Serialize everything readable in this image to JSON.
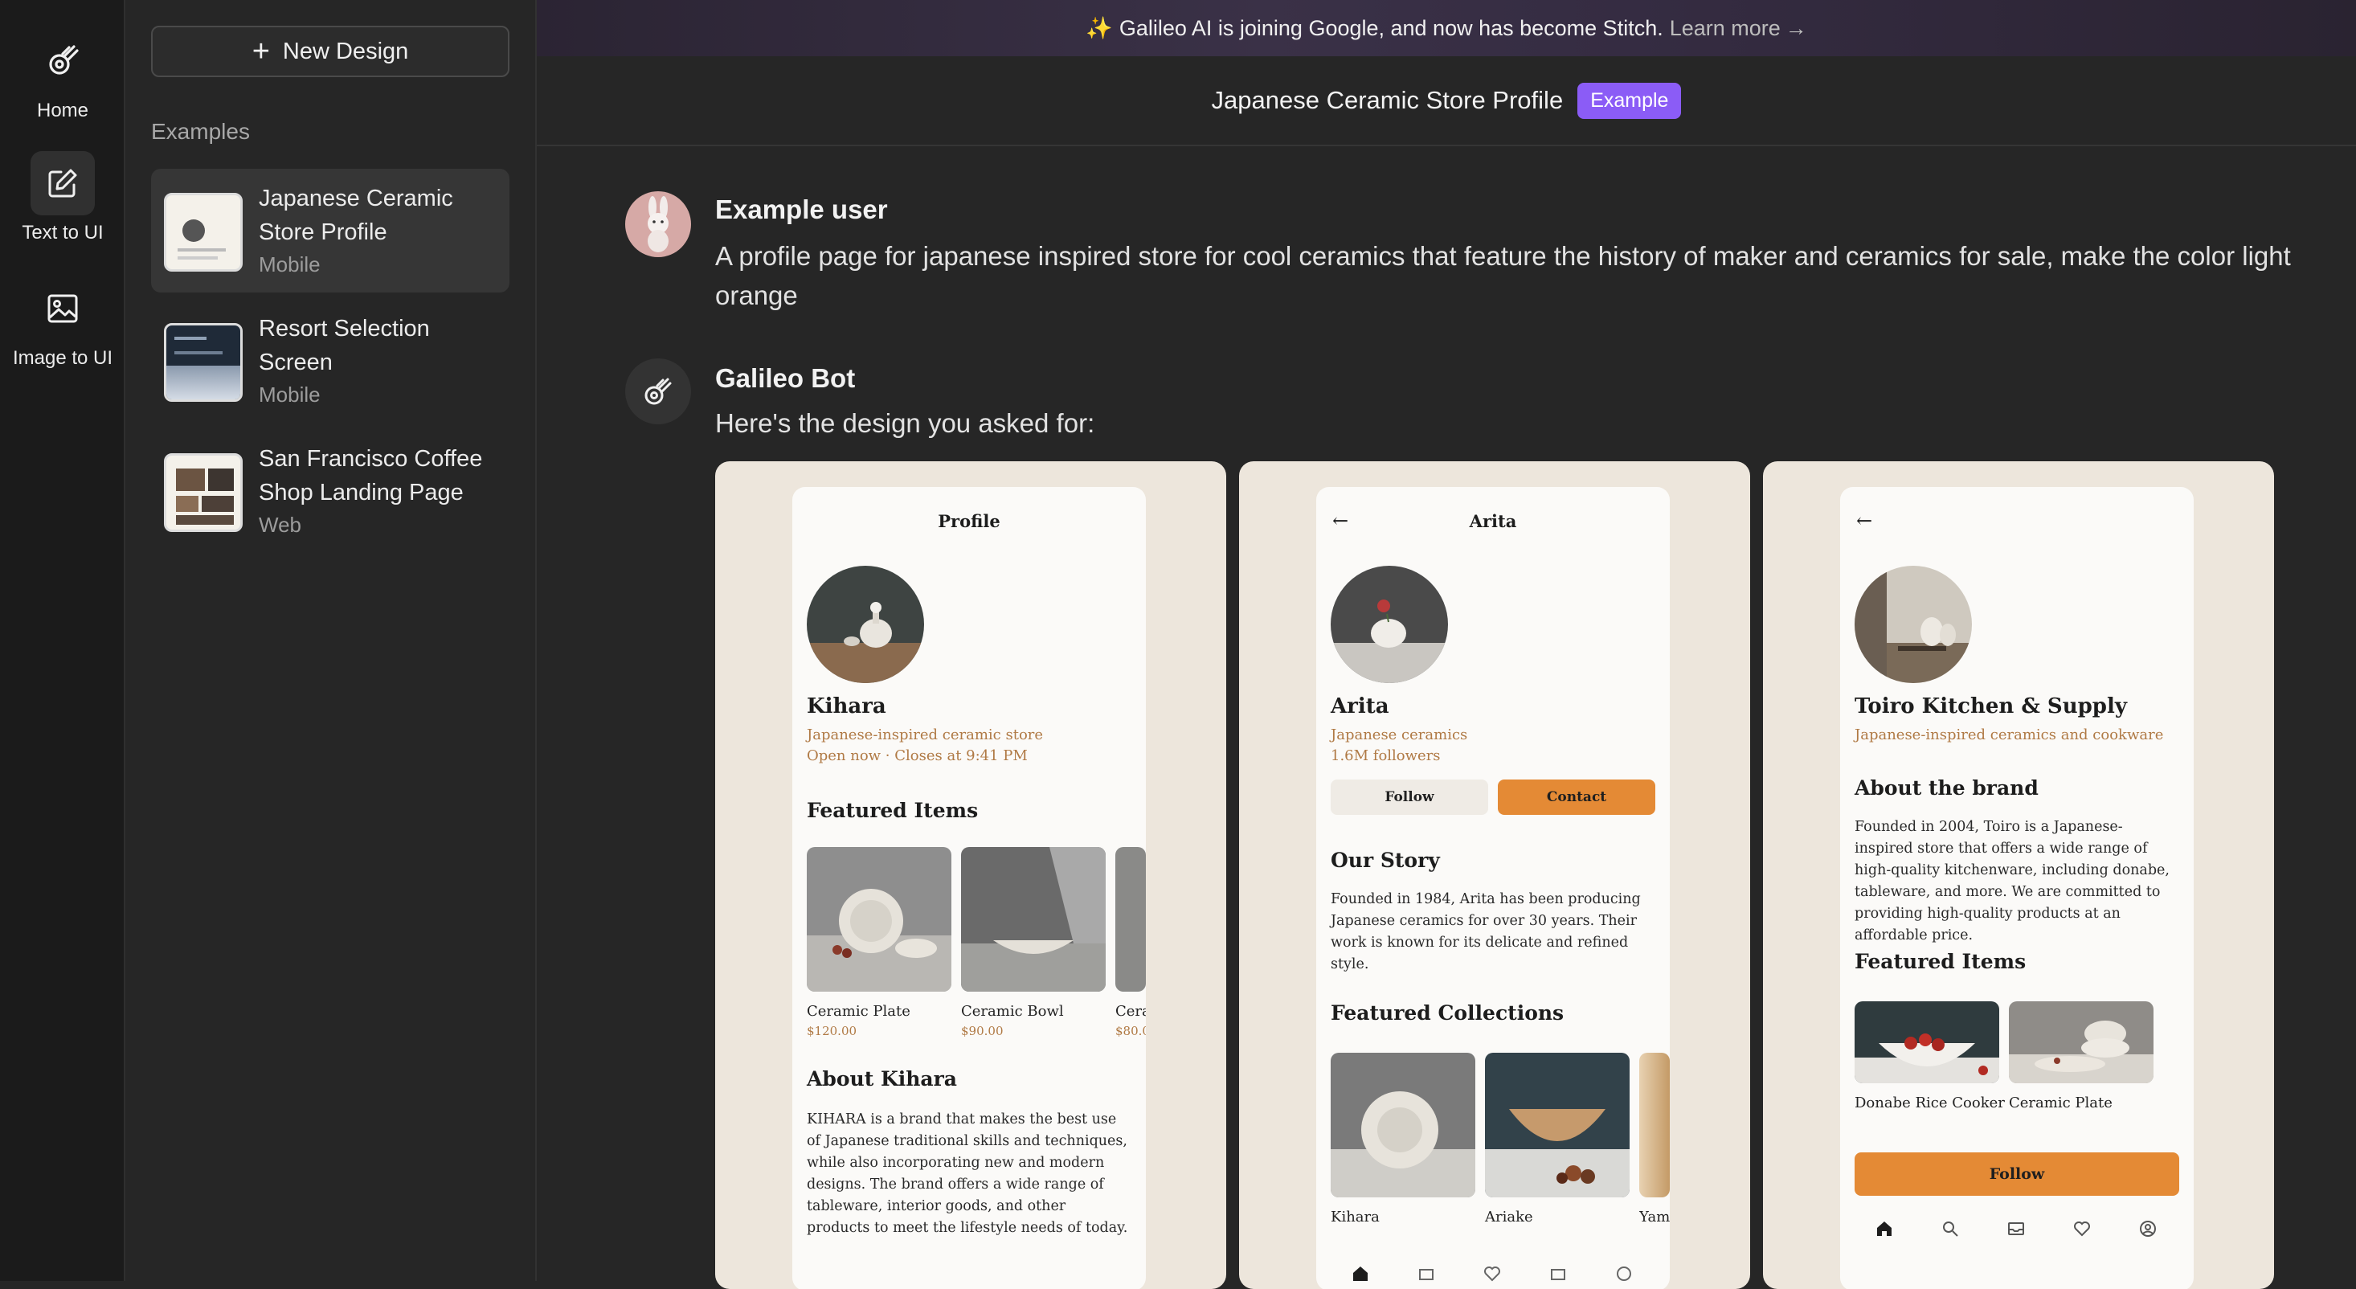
{
  "rail": {
    "home_label": "Home",
    "text_to_ui_label": "Text to UI",
    "image_to_ui_label": "Image to UI"
  },
  "sidebar": {
    "new_design_label": "New Design",
    "examples_heading": "Examples",
    "examples": [
      {
        "title": "Japanese Ceramic Store Profile",
        "platform": "Mobile"
      },
      {
        "title": "Resort Selection Screen",
        "platform": "Mobile"
      },
      {
        "title": "San Francisco Coffee Shop Landing Page",
        "platform": "Web"
      }
    ]
  },
  "banner": {
    "sparkle": "✨",
    "text": "Galileo AI is joining Google, and now has become Stitch.",
    "link": "Learn more"
  },
  "header": {
    "title": "Japanese Ceramic Store Profile",
    "badge": "Example"
  },
  "chat": {
    "user_name": "Example user",
    "user_prompt": "A profile page for japanese inspired store for cool ceramics that feature the history of maker and ceramics for sale, make the color light orange",
    "bot_name": "Galileo Bot",
    "bot_reply": "Here's the design you asked for:"
  },
  "designs": [
    {
      "header": "Profile",
      "name": "Kihara",
      "subtitle": "Japanese-inspired ceramic store",
      "hours": "Open now · Closes at 9:41 PM",
      "featured_heading": "Featured Items",
      "items": [
        {
          "name": "Ceramic Plate",
          "price": "$120.00"
        },
        {
          "name": "Ceramic Bowl",
          "price": "$90.00"
        },
        {
          "name": "Cera",
          "price": "$80.0"
        }
      ],
      "about_heading": "About Kihara",
      "about_text": "KIHARA is a brand that makes the best use of Japanese traditional skills and techniques, while also incorporating new and modern designs. The brand offers a wide range of tableware, interior goods, and other products to meet the lifestyle needs of today."
    },
    {
      "header": "Arita",
      "name": "Arita",
      "subtitle": "Japanese ceramics",
      "followers": "1.6M followers",
      "follow_label": "Follow",
      "contact_label": "Contact",
      "story_heading": "Our Story",
      "story_text": "Founded in 1984, Arita has been producing Japanese ceramics for over 30 years. Their work is known for its delicate and refined style.",
      "collections_heading": "Featured Collections",
      "collections": [
        "Kihara",
        "Ariake",
        "Yam"
      ]
    },
    {
      "name": "Toiro Kitchen & Supply",
      "subtitle": "Japanese-inspired ceramics and cookware",
      "about_heading": "About the brand",
      "about_text": "Founded in 2004, Toiro is a Japanese-inspired store that offers a wide range of high-quality kitchenware, including donabe, tableware, and more. We are committed to providing high-quality products at an affordable price.",
      "featured_heading": "Featured Items",
      "items": [
        "Donabe Rice Cooker",
        "Ceramic Plate"
      ],
      "follow_label": "Follow"
    }
  ],
  "colors": {
    "accent_orange": "#e48a35",
    "badge_purple": "#8b5cf6",
    "card_bg": "#ede6dc",
    "muted_brown": "#b07a45"
  }
}
